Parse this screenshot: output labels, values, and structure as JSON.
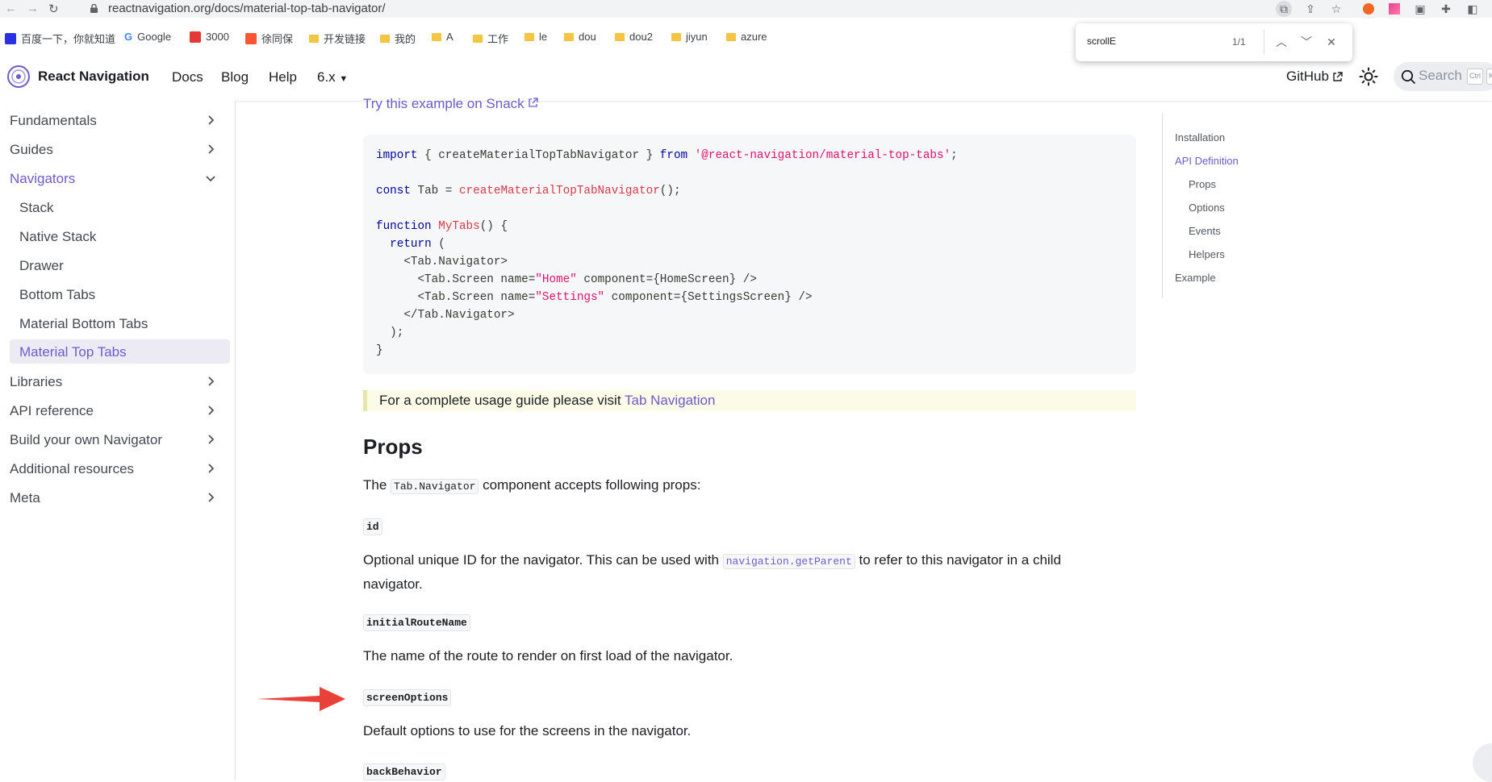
{
  "browser": {
    "url": "reactnavigation.org/docs/material-top-tab-navigator/",
    "bookmarks": [
      {
        "label": "百度一下，你就知道",
        "icon": "baidu-icon"
      },
      {
        "label": "Google",
        "icon": "google-icon"
      },
      {
        "label": "3000",
        "icon": "bookmark-icon"
      },
      {
        "label": "徐同保",
        "icon": "csdn-icon"
      },
      {
        "label": "开发链接",
        "icon": "folder-icon"
      },
      {
        "label": "我的",
        "icon": "folder-icon"
      },
      {
        "label": "A",
        "icon": "folder-icon"
      },
      {
        "label": "工作",
        "icon": "folder-icon"
      },
      {
        "label": "le",
        "icon": "folder-icon"
      },
      {
        "label": "dou",
        "icon": "folder-icon"
      },
      {
        "label": "dou2",
        "icon": "folder-icon"
      },
      {
        "label": "jiyun",
        "icon": "folder-icon"
      },
      {
        "label": "azure",
        "icon": "folder-icon"
      }
    ]
  },
  "findbar": {
    "query": "scrollE",
    "count": "1/1"
  },
  "navbar": {
    "title": "React Navigation",
    "links": [
      "Docs",
      "Blog",
      "Help"
    ],
    "version": "6.x",
    "github": "GitHub",
    "search_placeholder": "Search",
    "kbd1": "Ctrl",
    "kbd2": "K"
  },
  "sidebar": {
    "items": [
      {
        "label": "Fundamentals"
      },
      {
        "label": "Guides"
      },
      {
        "label": "Navigators"
      },
      {
        "label": "Stack"
      },
      {
        "label": "Native Stack"
      },
      {
        "label": "Drawer"
      },
      {
        "label": "Bottom Tabs"
      },
      {
        "label": "Material Bottom Tabs"
      },
      {
        "label": "Material Top Tabs"
      },
      {
        "label": "Libraries"
      },
      {
        "label": "API reference"
      },
      {
        "label": "Build your own Navigator"
      },
      {
        "label": "Additional resources"
      },
      {
        "label": "Meta"
      }
    ]
  },
  "content": {
    "snack_link": "Try this example on Snack",
    "code": {
      "l1_import": "import",
      "l1_mid": " { createMaterialTopTabNavigator } ",
      "l1_from": "from",
      "l1_str": "'@react-navigation/material-top-tabs'",
      "l1_end": ";",
      "l2_const": "const",
      "l2_mid": " Tab = ",
      "l2_fn": "createMaterialTopTabNavigator",
      "l2_end": "();",
      "l3_function": "function",
      "l3_fn": "MyTabs",
      "l3_end": "() {",
      "l4_return": "return",
      "l4_end": " (",
      "l5": "    <Tab.Navigator>",
      "l6_a": "      <Tab.Screen name=",
      "l6_str": "\"Home\"",
      "l6_b": " component={HomeScreen} />",
      "l7_a": "      <Tab.Screen name=",
      "l7_str": "\"Settings\"",
      "l7_b": " component={SettingsScreen} />",
      "l8": "    </Tab.Navigator>",
      "l9": "  );",
      "l10": "}"
    },
    "callout_text": "For a complete usage guide please visit ",
    "callout_link": "Tab Navigation",
    "props_heading": "Props",
    "props_intro_a": "The ",
    "props_intro_code": "Tab.Navigator",
    "props_intro_b": " component accepts following props:",
    "prop_id": "id",
    "prop_id_desc_a": "Optional unique ID for the navigator. This can be used with ",
    "prop_id_desc_code": "navigation.getParent",
    "prop_id_desc_b": " to refer to this navigator in a child navigator.",
    "prop_initial": "initialRouteName",
    "prop_initial_desc": "The name of the route to render on first load of the navigator.",
    "prop_screen": "screenOptions",
    "prop_screen_desc": "Default options to use for the screens in the navigator.",
    "prop_back": "backBehavior"
  },
  "toc": {
    "items": [
      "Installation",
      "API Definition",
      "Props",
      "Options",
      "Events",
      "Helpers",
      "Example"
    ]
  },
  "colors": {
    "primary": "#6e5bcb",
    "arrow": "#e8413a"
  }
}
